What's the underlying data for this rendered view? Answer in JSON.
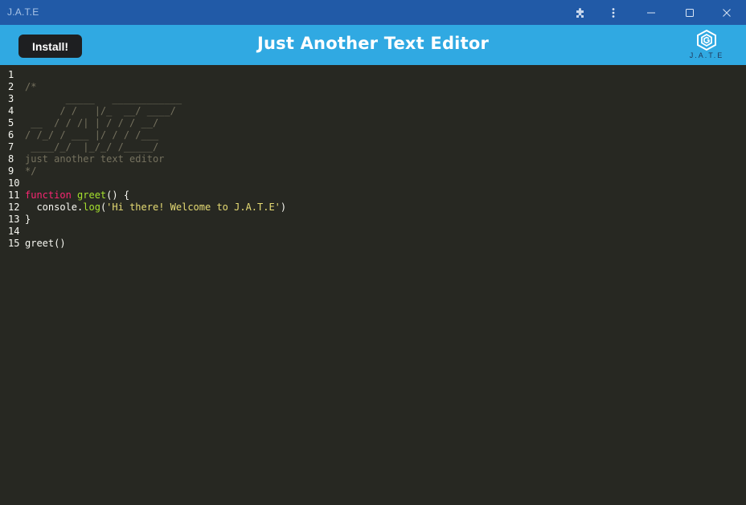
{
  "window": {
    "title": "J.A.T.E"
  },
  "header": {
    "install_label": "Install!",
    "app_title": "Just Another Text Editor",
    "logo_text": "J.A.T.E"
  },
  "colors": {
    "titlebar": "#215aa7",
    "header": "#30a9e2",
    "editor_bg": "#272822",
    "comment": "#75715e",
    "keyword": "#f92672",
    "function": "#a6e22e",
    "string": "#e6db74"
  },
  "editor": {
    "lines": [
      {
        "num": "1",
        "tokens": []
      },
      {
        "num": "2",
        "tokens": [
          {
            "t": "comment",
            "v": "/*"
          }
        ]
      },
      {
        "num": "3",
        "tokens": [
          {
            "t": "comment",
            "v": "       _____   ____________"
          }
        ]
      },
      {
        "num": "4",
        "tokens": [
          {
            "t": "comment",
            "v": "      / /   |/_  __/ ____/"
          }
        ]
      },
      {
        "num": "5",
        "tokens": [
          {
            "t": "comment",
            "v": " __  / / /| | / / / __/"
          }
        ]
      },
      {
        "num": "6",
        "tokens": [
          {
            "t": "comment",
            "v": "/ /_/ / ___ |/ / / /___"
          }
        ]
      },
      {
        "num": "7",
        "tokens": [
          {
            "t": "comment",
            "v": " ____/_/  |_/_/ /_____/"
          }
        ]
      },
      {
        "num": "8",
        "tokens": [
          {
            "t": "comment",
            "v": "just another text editor"
          }
        ]
      },
      {
        "num": "9",
        "tokens": [
          {
            "t": "comment",
            "v": "*/"
          }
        ]
      },
      {
        "num": "10",
        "tokens": []
      },
      {
        "num": "11",
        "tokens": [
          {
            "t": "keyword",
            "v": "function"
          },
          {
            "t": "plain",
            "v": " "
          },
          {
            "t": "fn",
            "v": "greet"
          },
          {
            "t": "plain",
            "v": "() {"
          }
        ]
      },
      {
        "num": "12",
        "tokens": [
          {
            "t": "plain",
            "v": "  console."
          },
          {
            "t": "fn",
            "v": "log"
          },
          {
            "t": "plain",
            "v": "("
          },
          {
            "t": "str",
            "v": "'Hi there! Welcome to J.A.T.E'"
          },
          {
            "t": "plain",
            "v": ")"
          }
        ]
      },
      {
        "num": "13",
        "tokens": [
          {
            "t": "plain",
            "v": "}"
          }
        ]
      },
      {
        "num": "14",
        "tokens": []
      },
      {
        "num": "15",
        "tokens": [
          {
            "t": "plain",
            "v": "greet()"
          }
        ]
      }
    ]
  }
}
